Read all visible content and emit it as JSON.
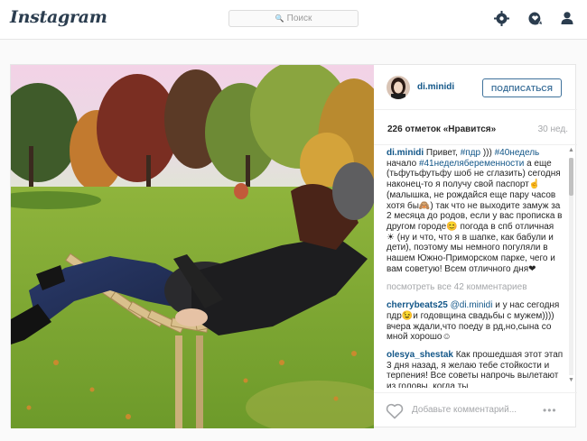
{
  "nav": {
    "logo": "Instagram",
    "search_placeholder": "Поиск",
    "icons": [
      "explore-icon",
      "activity-icon",
      "profile-icon"
    ]
  },
  "post": {
    "username": "di.minidi",
    "follow_label": "ПОДПИСАТЬСЯ",
    "likes": "226 отметок «Нравится»",
    "age": "30 нед.",
    "caption": {
      "author": "di.minidi",
      "p1": " Привет, ",
      "tag1": "#пдр",
      "p2": " ))) ",
      "tag2": "#40недель",
      "p3": " начало ",
      "tag3": "#41неделябеременности",
      "p4": " а еще (тьфутьфутьфу шоб не сглазить) сегодня наконец-то я получу свой паспорт☝ (малышка, не рождайся еще пару часов хотя бы🙈) так что не выходите замуж за 2 месяца до родов, если у вас прописка в другом городе😊 погода в спб отличная ☀ (ну и что, что я в шапке, как бабули и дети), поэтому мы немного погуляли в нашем Южно-Приморском парке, чего и вам советую! Всем отличного дня❤"
    },
    "view_more": "посмотреть все 42 комментариев",
    "comments": [
      {
        "author": "cherrybeats25",
        "mention": "@di.minidi",
        "text": " и у нас сегодня пдр😉и годовщина свадьбы с мужем)))) вчера ждали,что поеду в рд,но,сына со мной хорошо☺"
      },
      {
        "author": "olesya_shestak",
        "mention": "",
        "text": " Как прошедшая этот этап 3 дня назад, я желаю тебе стойкости и терпения! Все советы напрочь вылетают из головы, когда ты"
      }
    ],
    "add_comment_placeholder": "Добавьте комментарий...",
    "more_options": "•••"
  },
  "colors": {
    "link": "#125688",
    "follow": "#3f729b",
    "muted": "#a5a7aa",
    "logo": "#2b3d4f"
  }
}
